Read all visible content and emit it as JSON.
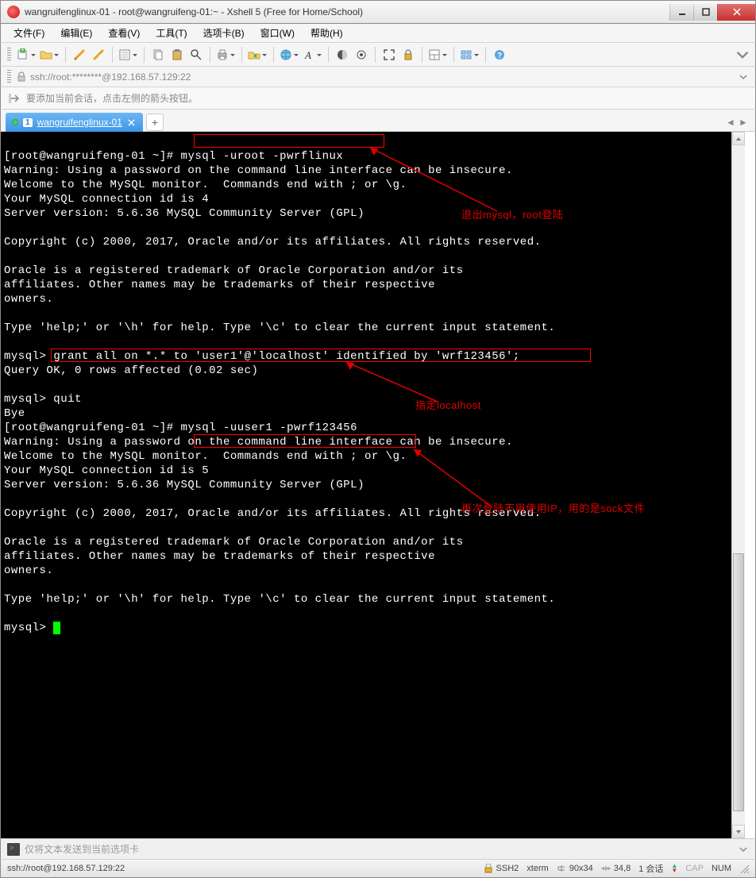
{
  "window": {
    "title": "wangruifenglinux-01 - root@wangruifeng-01:~ - Xshell 5 (Free for Home/School)"
  },
  "menu": {
    "file": "文件(F)",
    "edit": "编辑(E)",
    "view": "查看(V)",
    "tools": "工具(T)",
    "tabs": "选项卡(B)",
    "window": "窗口(W)",
    "help": "帮助(H)"
  },
  "address": "ssh://root:********@192.168.57.129:22",
  "hint": "要添加当前会话，点击左侧的箭头按钮。",
  "tab": {
    "num": "1",
    "label": "wangruifenglinux-01"
  },
  "terminal": {
    "l01a": "[root@wangruifeng-01 ~]# ",
    "l01b": "mysql -uroot -pwrflinux",
    "l02": "Warning: Using a password on the command line interface can be insecure.",
    "l03": "Welcome to the MySQL monitor.  Commands end with ; or \\g.",
    "l04": "Your MySQL connection id is 4",
    "l05": "Server version: 5.6.36 MySQL Community Server (GPL)",
    "l06": "",
    "l07": "Copyright (c) 2000, 2017, Oracle and/or its affiliates. All rights reserved.",
    "l08": "",
    "l09": "Oracle is a registered trademark of Oracle Corporation and/or its",
    "l10": "affiliates. Other names may be trademarks of their respective",
    "l11": "owners.",
    "l12": "",
    "l13": "Type 'help;' or '\\h' for help. Type '\\c' to clear the current input statement.",
    "l14": "",
    "l15a": "mysql> ",
    "l15b": "grant all on *.* to 'user1'@'localhost' identified by 'wrf123456';",
    "l16": "Query OK, 0 rows affected (0.02 sec)",
    "l17": "",
    "l18": "mysql> quit",
    "l19": "Bye",
    "l20a": "[root@wangruifeng-01 ~]# ",
    "l20b": "mysql -uuser1 -pwrf123456",
    "l21": "Warning: Using a password on the command line interface can be insecure.",
    "l22": "Welcome to the MySQL monitor.  Commands end with ; or \\g.",
    "l23": "Your MySQL connection id is 5",
    "l24": "Server version: 5.6.36 MySQL Community Server (GPL)",
    "l25": "",
    "l26": "Copyright (c) 2000, 2017, Oracle and/or its affiliates. All rights reserved.",
    "l27": "",
    "l28": "Oracle is a registered trademark of Oracle Corporation and/or its",
    "l29": "affiliates. Other names may be trademarks of their respective",
    "l30": "owners.",
    "l31": "",
    "l32": "Type 'help;' or '\\h' for help. Type '\\c' to clear the current input statement.",
    "l33": "",
    "l34": "mysql> "
  },
  "annotations": {
    "a1": "退出mysql，root登陆",
    "a2": "指定localhost",
    "a3": "再次登陆不用使用IP，用的是sock文件"
  },
  "sendbar": "仅将文本发送到当前选项卡",
  "status": {
    "connection": "ssh://root@192.168.57.129:22",
    "proto": "SSH2",
    "term": "xterm",
    "size": "90x34",
    "cursor": "34,8",
    "sessions": "1 会话",
    "cap": "CAP",
    "num": "NUM"
  }
}
